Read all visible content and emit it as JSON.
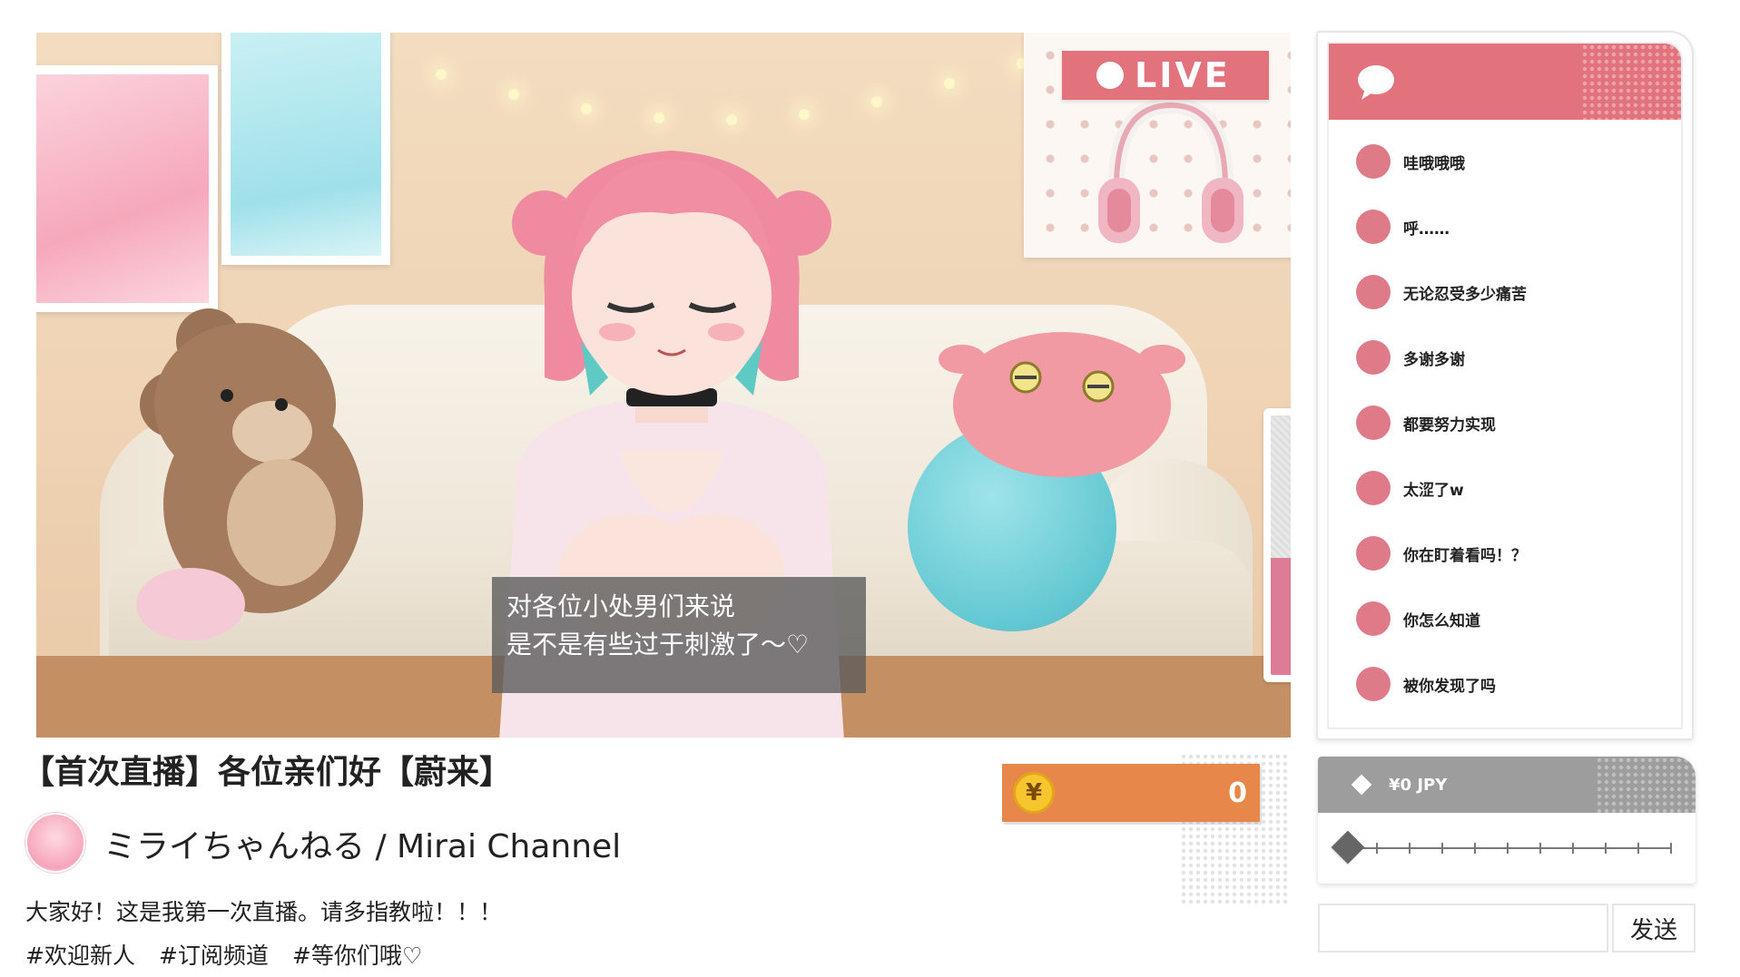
{
  "live_badge": {
    "label": "LIVE"
  },
  "subtitle": {
    "line1": "对各位小处男们来说",
    "line2": "是不是有些过于刺激了～♡"
  },
  "meter": {
    "fill_fraction": 0.45,
    "color": "#de7c98"
  },
  "stream_info": {
    "title": "【首次直播】各位亲们好【蔚来】",
    "channel_name": "ミライちゃんねる / Mirai Channel",
    "description": "大家好！这是我第一次直播。请多指教啦！！！",
    "tags": [
      "#欢迎新人",
      "#订阅频道",
      "#等你们哦♡"
    ]
  },
  "coins": {
    "symbol": "¥",
    "count": "0"
  },
  "chat": {
    "messages": [
      {
        "text": "哇哦哦哦"
      },
      {
        "text": "呼……"
      },
      {
        "text": "无论忍受多少痛苦"
      },
      {
        "text": "多谢多谢"
      },
      {
        "text": "都要努力实现"
      },
      {
        "text": "太涩了w"
      },
      {
        "text": "你在盯着看吗！？"
      },
      {
        "text": "你怎么知道"
      },
      {
        "text": "被你发现了吗"
      }
    ]
  },
  "tip": {
    "amount_label": "¥0 JPY",
    "slider_fraction": 0
  },
  "composer": {
    "input_value": "",
    "send_label": "发送"
  },
  "colors": {
    "accent": "#e2727b",
    "coin_bg": "#e8874a",
    "tip_header": "#9d9d9d"
  },
  "icons": {
    "chat_header": "speech-bubble-icon",
    "coin": "yen-coin-icon",
    "tip": "diamond-icon"
  }
}
